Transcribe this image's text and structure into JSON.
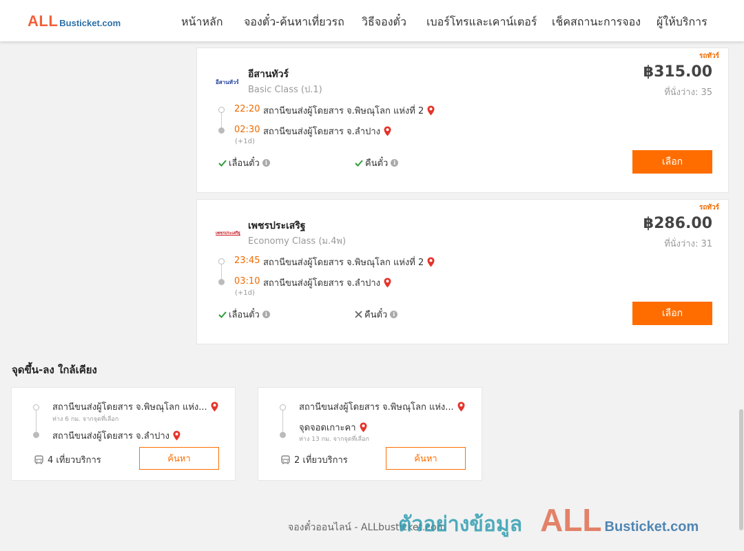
{
  "header": {
    "logo_all": "ALL",
    "logo_rest": "Busticket.com",
    "nav": [
      "หน้าหลัก",
      "จองตั๋ว-ค้นหาเที่ยวรถ",
      "วิธีจองตั๋ว",
      "เบอร์โทรและเคาน์เตอร์",
      "เช็คสถานะการจอง",
      "ผู้ให้บริการ"
    ]
  },
  "trips": [
    {
      "tag": "รถทัวร์",
      "operator": "อีสานทัวร์",
      "logo_text": "อีสานทัวร์",
      "bus_class": "Basic Class (ป.1)",
      "price": "฿315.00",
      "seats": "ที่นั่งว่าง: 35",
      "depart_time": "22:20",
      "depart_station": "สถานีขนส่งผู้โดยสาร จ.พิษณุโลก แห่งที่ 2",
      "arrive_time": "02:30",
      "arrive_station": "สถานีขนส่งผู้โดยสาร จ.ลำปาง",
      "next_day": "(+1d)",
      "reschedule_label": "เลื่อนตั๋ว",
      "reschedule_allowed": true,
      "refund_label": "คืนตั๋ว",
      "refund_allowed": true,
      "select_label": "เลือก"
    },
    {
      "tag": "รถทัวร์",
      "operator": "เพชรประเสริฐ",
      "logo_text": "เพชรประเสริฐ",
      "bus_class": "Economy Class (ม.4พ)",
      "price": "฿286.00",
      "seats": "ที่นั่งว่าง: 31",
      "depart_time": "23:45",
      "depart_station": "สถานีขนส่งผู้โดยสาร จ.พิษณุโลก แห่งที่ 2",
      "arrive_time": "03:10",
      "arrive_station": "สถานีขนส่งผู้โดยสาร จ.ลำปาง",
      "next_day": "(+1d)",
      "reschedule_label": "เลื่อนตั๋ว",
      "reschedule_allowed": true,
      "refund_label": "คืนตั๋ว",
      "refund_allowed": false,
      "select_label": "เลือก"
    }
  ],
  "nearby": {
    "title": "จุดขึ้น-ลง ใกล้เคียง",
    "cards": [
      {
        "from": "สถานีขนส่งผู้โดยสาร จ.พิษณุโลก แห่ง...",
        "from_distance": "ห่าง 6 กม. จากจุดที่เลือก",
        "to": "สถานีขนส่งผู้โดยสาร จ.ลำปาง",
        "to_distance": "",
        "trips": "4 เที่ยวบริการ",
        "search_label": "ค้นหา"
      },
      {
        "from": "สถานีขนส่งผู้โดยสาร จ.พิษณุโลก แห่ง...",
        "from_distance": "",
        "to": "จุดจอดเกาะคา",
        "to_distance": "ห่าง 13 กม. จากจุดที่เลือก",
        "trips": "2 เที่ยวบริการ",
        "search_label": "ค้นหา"
      }
    ]
  },
  "footer": {
    "text": "จองตั๋วออนไลน์ - ALLbusticket.com",
    "watermark_thai": "ตัวอย่างข้อมูล",
    "watermark_all": "ALL",
    "watermark_rest": "Busticket.com"
  },
  "colors": {
    "accent": "#ff6d00",
    "time": "#ef6a00",
    "pin": "#e5342b",
    "check": "#2e9d3a"
  }
}
